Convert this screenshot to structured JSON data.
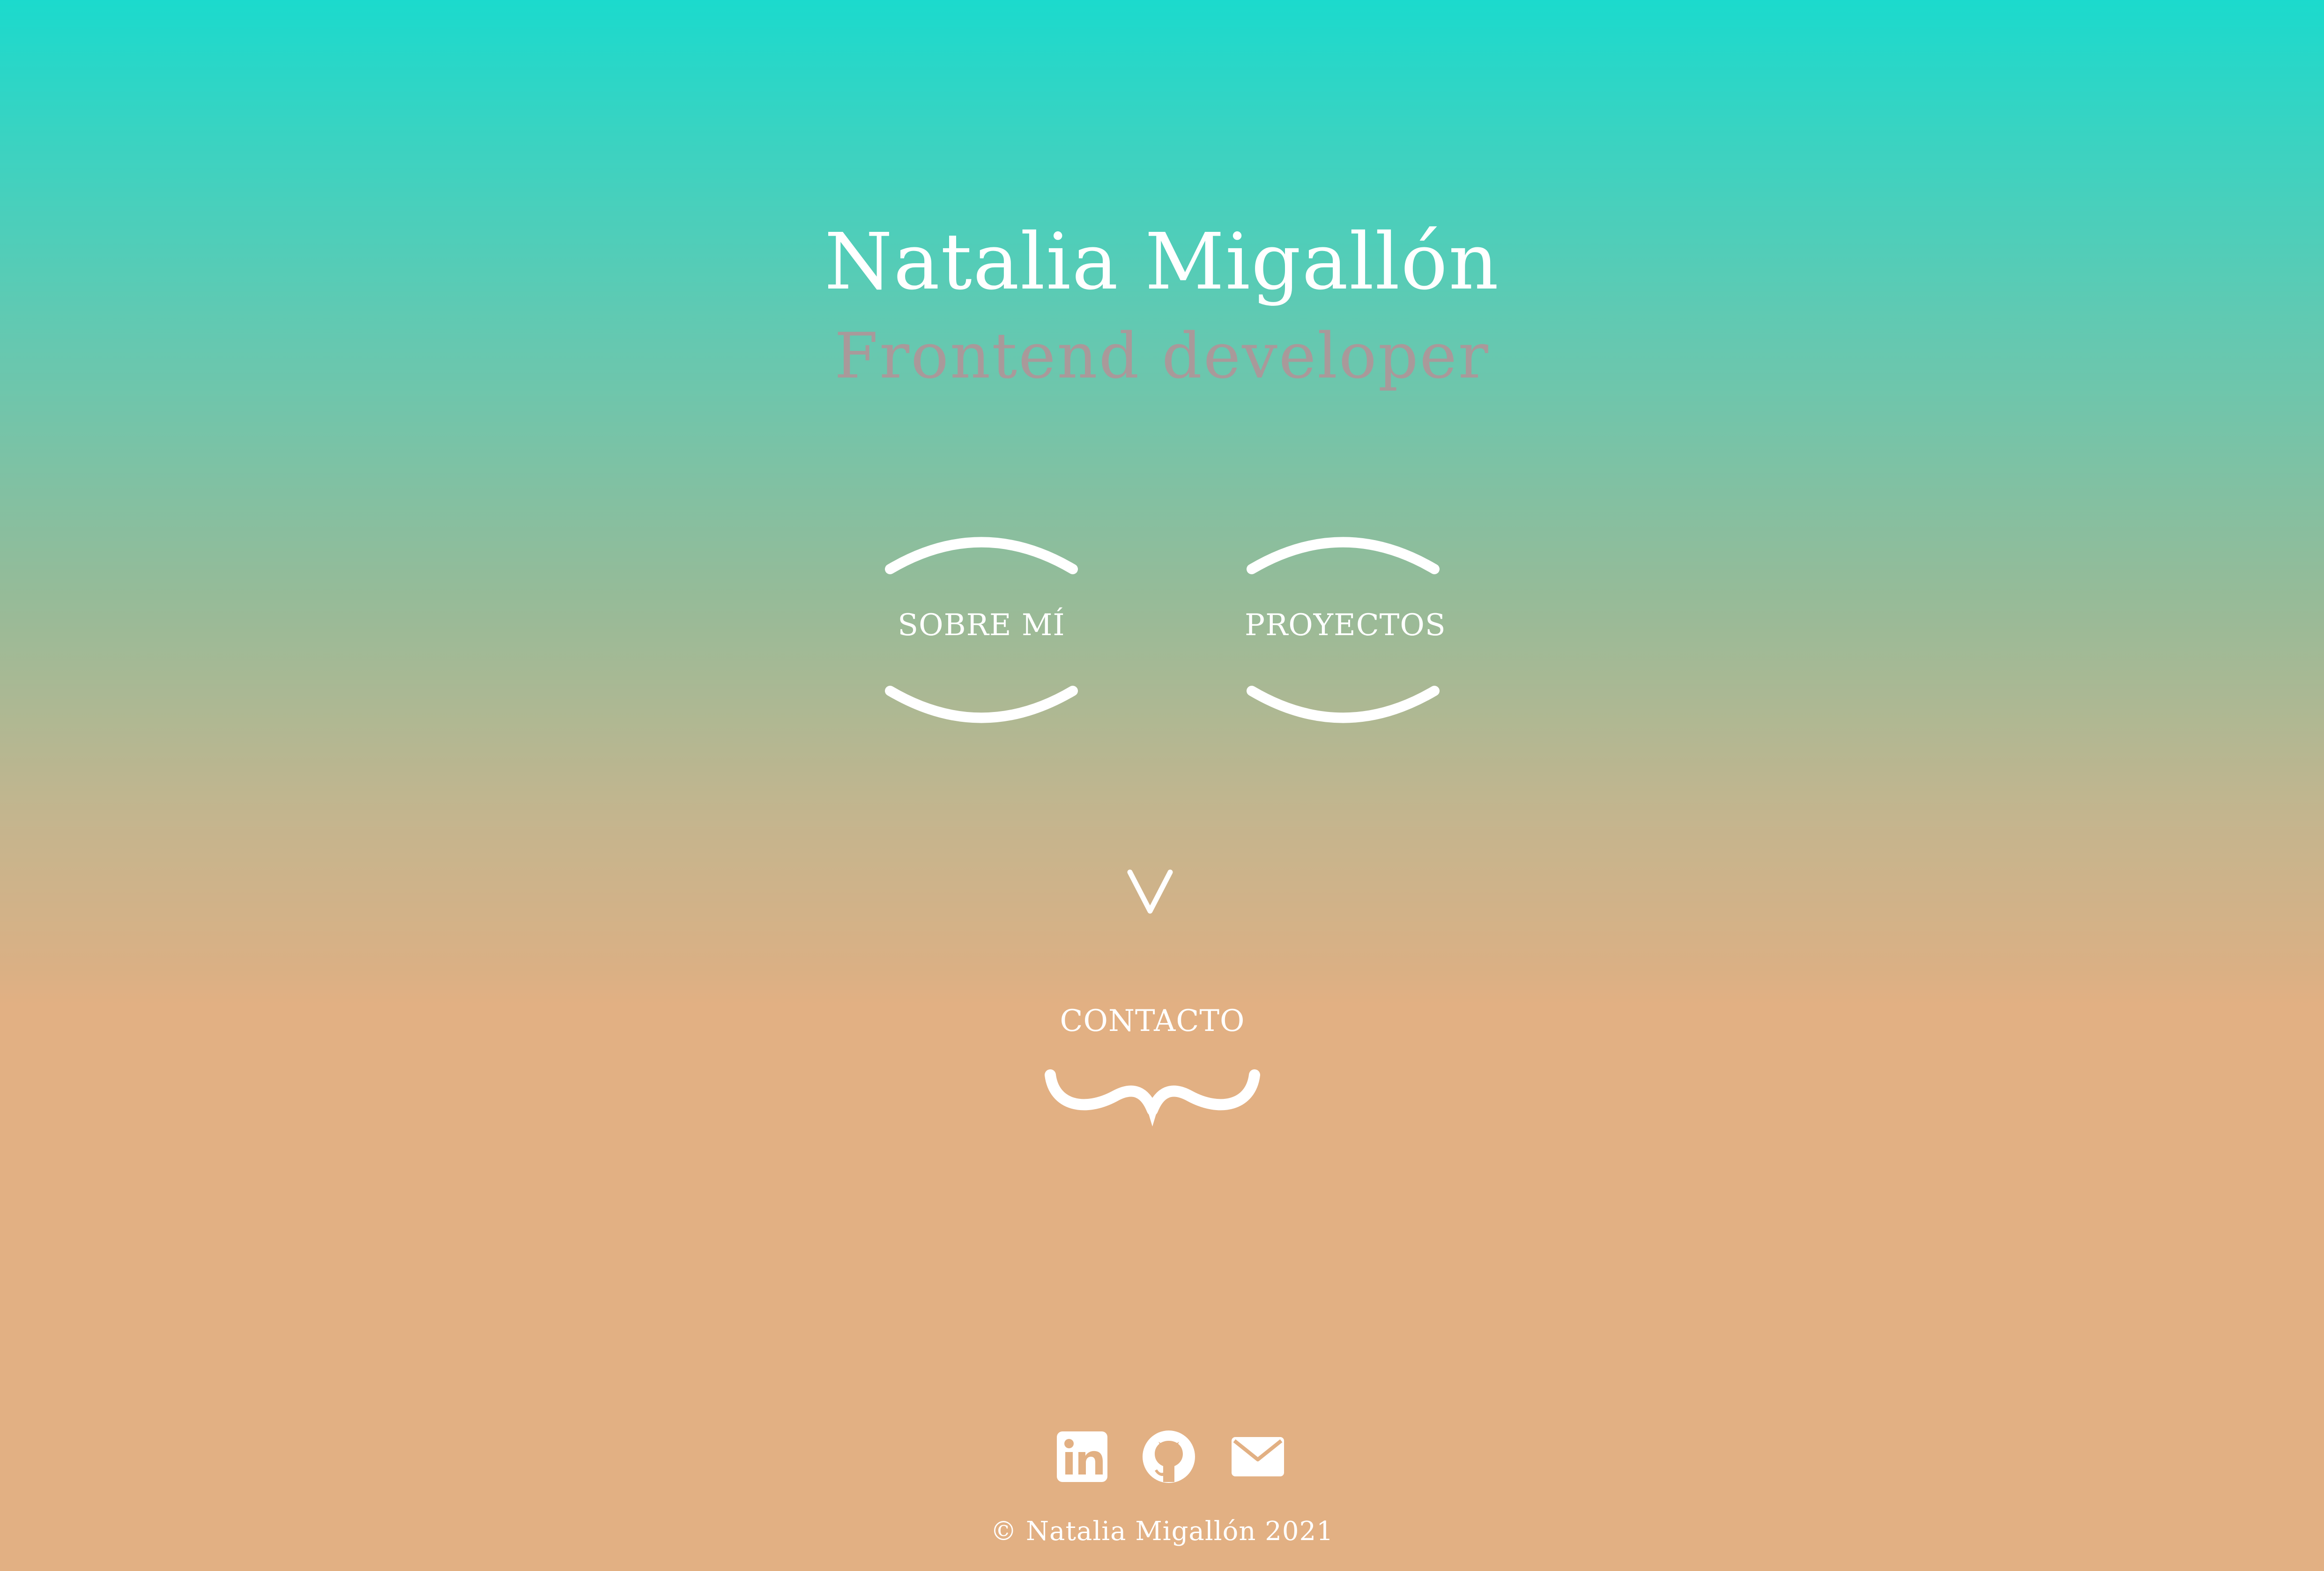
{
  "header": {
    "name": "Natalia Migallón",
    "role": "Frontend developer"
  },
  "nav": {
    "about_label": "SOBRE MÍ",
    "projects_label": "PROYECTOS",
    "contact_label": "CONTACTO"
  },
  "social": {
    "items": [
      {
        "name": "linkedin",
        "icon": "linkedin-icon"
      },
      {
        "name": "github",
        "icon": "github-icon"
      },
      {
        "name": "email",
        "icon": "mail-icon"
      }
    ]
  },
  "footer": {
    "copyright": "© Natalia Migallón 2021"
  },
  "colors": {
    "gradient_top": "#1bdacd",
    "gradient_bottom": "#e2b083",
    "text": "#ffffff",
    "subtitle": "#a9999a"
  }
}
